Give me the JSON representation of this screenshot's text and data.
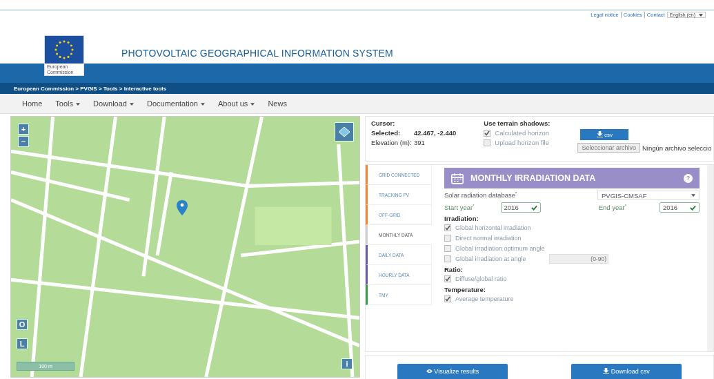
{
  "top_links": [
    "Legal notice",
    "Cookies",
    "Contact"
  ],
  "language": {
    "value": "English (en)"
  },
  "logo": {
    "line1": "European",
    "line2": "Commission"
  },
  "site_title": "PHOTOVOLTAIC GEOGRAPHICAL INFORMATION SYSTEM",
  "breadcrumb": "European Commission > PVGIS > Tools > Interactive tools",
  "nav": [
    {
      "label": "Home",
      "dropdown": false
    },
    {
      "label": "Tools",
      "dropdown": true
    },
    {
      "label": "Download",
      "dropdown": true
    },
    {
      "label": "Documentation",
      "dropdown": true
    },
    {
      "label": "About us",
      "dropdown": true
    },
    {
      "label": "News",
      "dropdown": false
    }
  ],
  "map": {
    "zoom_in": "+",
    "zoom_out": "−",
    "button_o": "O",
    "button_l": "L",
    "info": "i",
    "scale": "100 m"
  },
  "location": {
    "cursor_label": "Cursor:",
    "selected_label": "Selected:",
    "selected_value": "42.467, -2.440",
    "elevation_label": "Elevation (m):",
    "elevation_value": "391"
  },
  "shadows": {
    "title": "Use terrain shadows:",
    "options": [
      {
        "label": "Calculated horizon",
        "checked": true
      },
      {
        "label": "Upload horizon file",
        "checked": false
      }
    ]
  },
  "csv_button": "csv",
  "file_button": "Seleccionar archivo",
  "file_status": "Ningún archivo seleccio",
  "tabs": [
    {
      "label": "GRID CONNECTED",
      "color": "#f0883a",
      "selected": false
    },
    {
      "label": "TRACKING PV",
      "color": "#f0883a",
      "selected": false
    },
    {
      "label": "OFF-GRID",
      "color": "#f0883a",
      "selected": false
    },
    {
      "label": "MONTHLY DATA",
      "color": "#d0d0d0",
      "selected": true
    },
    {
      "label": "DAILY DATA",
      "color": "#6a5aa8",
      "selected": false
    },
    {
      "label": "HOURLY DATA",
      "color": "#6a5aa8",
      "selected": false
    },
    {
      "label": "TMY",
      "color": "#3a9a4a",
      "selected": false
    }
  ],
  "panel": {
    "title": "MONTHLY IRRADIATION DATA",
    "help": "?",
    "db_label": "Solar radiation database$^{*}$",
    "db_value": "PVGIS-CMSAF",
    "start_label": "Start year$^{*}$",
    "start_value": "2016",
    "end_label": "End year$^{*}$",
    "end_value": "2016",
    "sections": [
      {
        "title": "Irradiation:",
        "items": [
          {
            "label": "Global horizontal irradiation",
            "checked": true
          },
          {
            "label": "Direct normal irradiation",
            "checked": false
          },
          {
            "label": "Global irradiation optimum angle",
            "checked": false
          },
          {
            "label": "Global irradiation at angle",
            "checked": false,
            "placeholder": "(0-90)"
          }
        ]
      },
      {
        "title": "Ratio:",
        "items": [
          {
            "label": "Diffuse/global ratio",
            "checked": true
          }
        ]
      },
      {
        "title": "Temperature:",
        "items": [
          {
            "label": "Average temperature",
            "checked": true
          }
        ]
      }
    ]
  },
  "actions": [
    "Visualize results",
    "Download csv"
  ]
}
